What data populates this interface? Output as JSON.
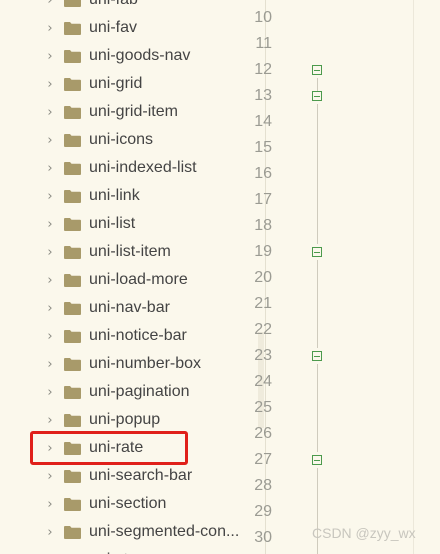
{
  "tree": {
    "items": [
      {
        "label": "uni-fab"
      },
      {
        "label": "uni-fav"
      },
      {
        "label": "uni-goods-nav"
      },
      {
        "label": "uni-grid"
      },
      {
        "label": "uni-grid-item"
      },
      {
        "label": "uni-icons"
      },
      {
        "label": "uni-indexed-list"
      },
      {
        "label": "uni-link"
      },
      {
        "label": "uni-list"
      },
      {
        "label": "uni-list-item"
      },
      {
        "label": "uni-load-more"
      },
      {
        "label": "uni-nav-bar"
      },
      {
        "label": "uni-notice-bar"
      },
      {
        "label": "uni-number-box"
      },
      {
        "label": "uni-pagination"
      },
      {
        "label": "uni-popup"
      },
      {
        "label": "uni-rate"
      },
      {
        "label": "uni-search-bar"
      },
      {
        "label": "uni-section"
      },
      {
        "label": "uni-segmented-con..."
      },
      {
        "label": "uni-steps"
      }
    ],
    "highlighted": "uni-rate",
    "chevron_glyph": "›"
  },
  "editor": {
    "line_numbers": [
      "10",
      "11",
      "12",
      "13",
      "14",
      "15",
      "16",
      "17",
      "18",
      "19",
      "20",
      "21",
      "22",
      "23",
      "24",
      "25",
      "26",
      "27",
      "28",
      "29",
      "30"
    ],
    "fold_lines": [
      "12",
      "13",
      "19",
      "23",
      "27"
    ]
  },
  "watermark": "CSDN @zyy_wx",
  "colors": {
    "background": "#fbf8ec",
    "folder": "#a89a6a",
    "highlight": "#e0201a",
    "fold_marker": "#4c9a4c"
  }
}
